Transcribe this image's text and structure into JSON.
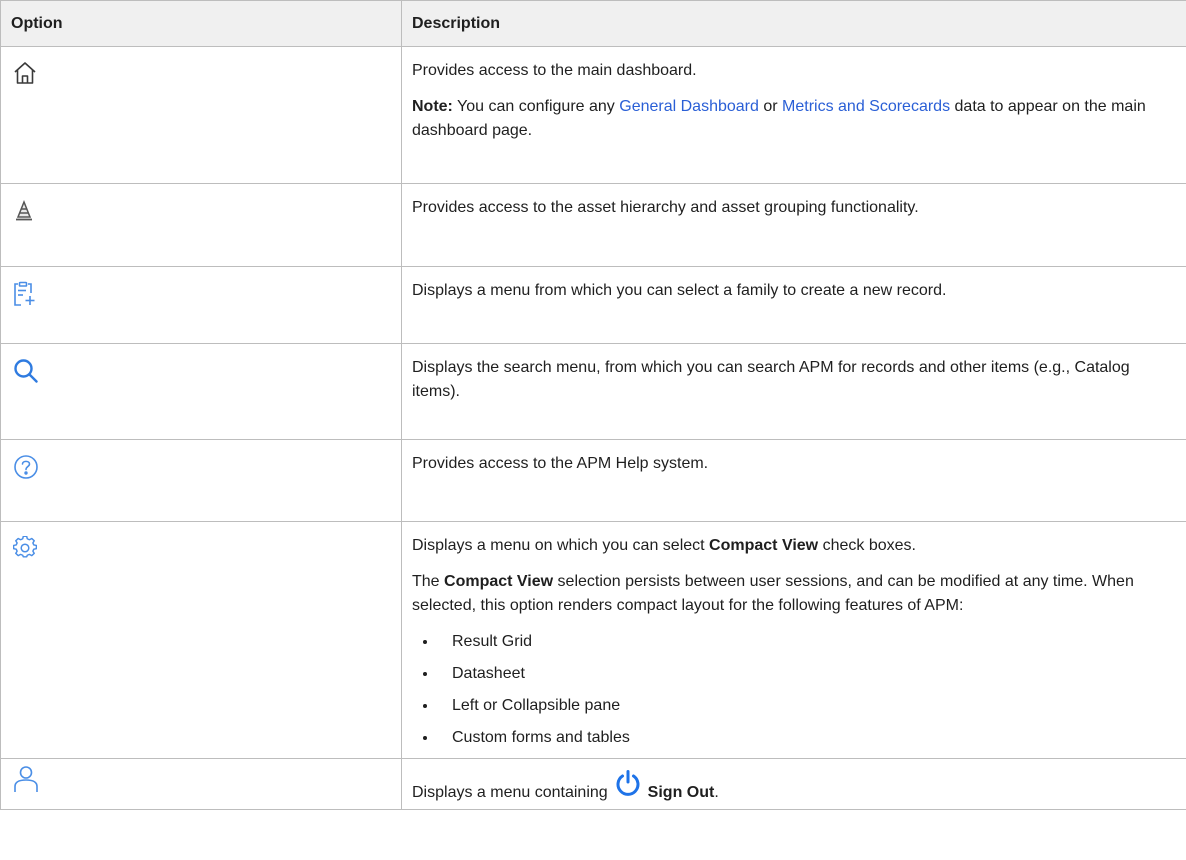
{
  "table": {
    "headers": {
      "option": "Option",
      "description": "Description"
    },
    "rows": {
      "home": {
        "icon": "home-icon",
        "description": "Provides access to the main dashboard.",
        "note_label": "Note:",
        "note_text_1": " You can configure any ",
        "link_general": "General Dashboard",
        "note_or": " or ",
        "link_metrics": "Metrics and Scorecards",
        "note_text_2": " data to appear on the main dashboard page."
      },
      "asset": {
        "icon": "asset-hierarchy-icon",
        "description": "Provides access to the asset hierarchy and asset grouping functionality."
      },
      "new_record": {
        "icon": "new-record-icon",
        "description": "Displays a menu from which you can select a family to create a new record."
      },
      "search": {
        "icon": "search-icon",
        "description": "Displays the search menu, from which you can search APM for records and other items (e.g., Catalog items)."
      },
      "help": {
        "icon": "help-icon",
        "description": "Provides access to the APM Help system."
      },
      "settings": {
        "icon": "gear-icon",
        "line1_a": "Displays a menu on which you can select ",
        "line1_bold": "Compact View",
        "line1_b": " check boxes.",
        "para_a": "The ",
        "para_bold": "Compact View",
        "para_b": " selection persists between user sessions, and can be modified at any time. When selected, this option renders compact layout for the following features of APM:",
        "features": [
          "Result Grid",
          "Datasheet",
          "Left or Collapsible pane",
          "Custom forms and tables"
        ]
      },
      "user": {
        "icon": "user-icon",
        "text_a": "Displays a menu containing ",
        "power_icon": "power-icon",
        "bold": "Sign Out",
        "text_b": "."
      }
    }
  },
  "colors": {
    "link": "#2a5fd6",
    "icon_blue": "#4a8ee6",
    "header_bg": "#f0f0f0",
    "border": "#bdbdbd"
  }
}
